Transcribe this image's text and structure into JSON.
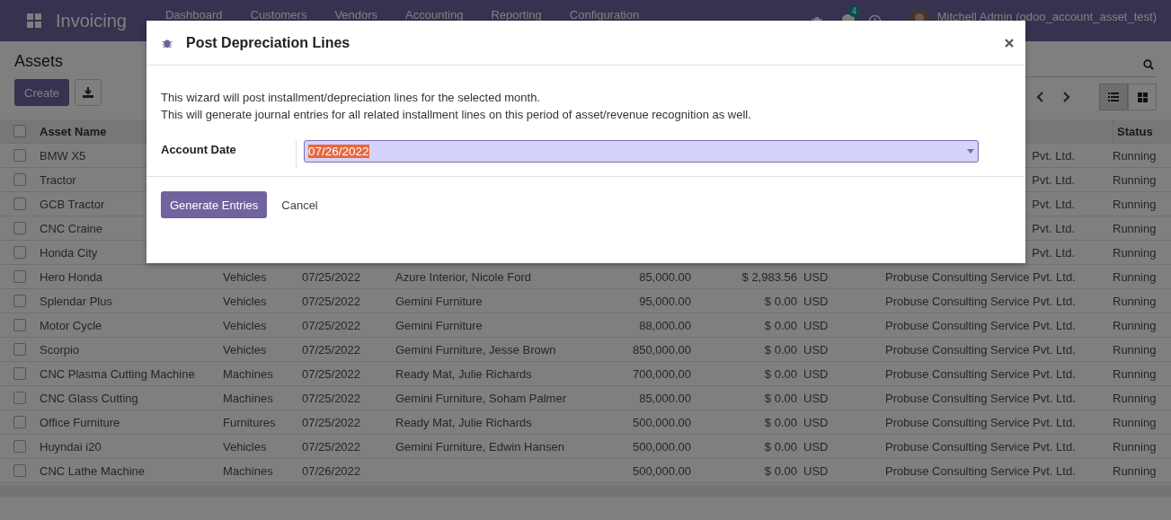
{
  "navbar": {
    "app_name": "Invoicing",
    "menu": [
      "Dashboard",
      "Customers",
      "Vendors",
      "Accounting",
      "Reporting",
      "Configuration"
    ],
    "message_count": "4",
    "user": "Mitchell Admin (odoo_account_asset_test)"
  },
  "control_panel": {
    "title": "Assets",
    "create_button": "Create",
    "views": [
      {
        "kind": "list",
        "selected": true
      },
      {
        "kind": "kanban",
        "selected": false
      }
    ]
  },
  "table": {
    "headers": {
      "all_checked": false,
      "asset_name": "Asset Name",
      "status": "Status"
    },
    "rows": [
      {
        "checked": false,
        "name": "BMW X5",
        "company": "Pvt. Ltd.",
        "status": "Running"
      },
      {
        "checked": false,
        "name": "Tractor",
        "company": "Pvt. Ltd.",
        "status": "Running"
      },
      {
        "checked": false,
        "name": "GCB Tractor",
        "company": "Pvt. Ltd.",
        "status": "Running"
      },
      {
        "checked": false,
        "name": "CNC Craine",
        "company": "Pvt. Ltd.",
        "status": "Running"
      },
      {
        "checked": false,
        "name": "Honda City",
        "company": "Pvt. Ltd.",
        "status": "Running"
      },
      {
        "checked": false,
        "name": "Hero Honda",
        "column_2": "Vehicles",
        "column_3": "07/25/2022",
        "column_4": "Azure Interior, Nicole Ford",
        "column_5": "85,000.00",
        "column_6": "$ 2,983.56",
        "column_7": "USD",
        "company": "Probuse Consulting Service Pvt. Ltd.",
        "status": "Running"
      },
      {
        "checked": false,
        "name": "Splendar Plus",
        "column_2": "Vehicles",
        "column_3": "07/25/2022",
        "column_4": "Gemini Furniture",
        "column_5": "95,000.00",
        "column_6": "$ 0.00",
        "column_7": "USD",
        "company": "Probuse Consulting Service Pvt. Ltd.",
        "status": "Running"
      },
      {
        "checked": false,
        "name": "Motor Cycle",
        "column_2": "Vehicles",
        "column_3": "07/25/2022",
        "column_4": "Gemini Furniture",
        "column_5": "88,000.00",
        "column_6": "$ 0.00",
        "column_7": "USD",
        "company": "Probuse Consulting Service Pvt. Ltd.",
        "status": "Running"
      },
      {
        "checked": false,
        "name": "Scorpio",
        "column_2": "Vehicles",
        "column_3": "07/25/2022",
        "column_4": "Gemini Furniture, Jesse Brown",
        "column_5": "850,000.00",
        "column_6": "$ 0.00",
        "column_7": "USD",
        "company": "Probuse Consulting Service Pvt. Ltd.",
        "status": "Running"
      },
      {
        "checked": false,
        "name": "CNC Plasma Cutting Machine",
        "column_2": "Machines",
        "column_3": "07/25/2022",
        "column_4": "Ready Mat, Julie Richards",
        "column_5": "700,000.00",
        "column_6": "$ 0.00",
        "column_7": "USD",
        "company": "Probuse Consulting Service Pvt. Ltd.",
        "status": "Running"
      },
      {
        "checked": false,
        "name": "CNC Glass Cutting",
        "column_2": "Machines",
        "column_3": "07/25/2022",
        "column_4": "Gemini Furniture, Soham Palmer",
        "column_5": "85,000.00",
        "column_6": "$ 0.00",
        "column_7": "USD",
        "company": "Probuse Consulting Service Pvt. Ltd.",
        "status": "Running"
      },
      {
        "checked": false,
        "name": "Office Furniture",
        "column_2": "Furnitures",
        "column_3": "07/25/2022",
        "column_4": "Ready Mat, Julie Richards",
        "column_5": "500,000.00",
        "column_6": "$ 0.00",
        "column_7": "USD",
        "company": "Probuse Consulting Service Pvt. Ltd.",
        "status": "Running"
      },
      {
        "checked": false,
        "name": "Huyndai i20",
        "column_2": "Vehicles",
        "column_3": "07/25/2022",
        "column_4": "Gemini Furniture, Edwin Hansen",
        "column_5": "500,000.00",
        "column_6": "$ 0.00",
        "column_7": "USD",
        "company": "Probuse Consulting Service Pvt. Ltd.",
        "status": "Running"
      },
      {
        "checked": false,
        "name": "CNC Lathe Machine",
        "column_2": "Machines",
        "column_3": "07/26/2022",
        "column_5": "500,000.00",
        "column_6": "$ 0.00",
        "column_7": "USD",
        "company": "Probuse Consulting Service Pvt. Ltd.",
        "status": "Running"
      }
    ]
  },
  "dialog": {
    "title": "Post Depreciation Lines",
    "description": [
      "This wizard will post installment/depreciation lines for the selected month.",
      "This will generate journal entries for all related installment lines on this period of asset/revenue recognition as well."
    ],
    "field_label": "Account Date",
    "field_value": "07/26/2022",
    "value_selected": true,
    "primary_button": "Generate Entries",
    "secondary_button": "Cancel"
  }
}
